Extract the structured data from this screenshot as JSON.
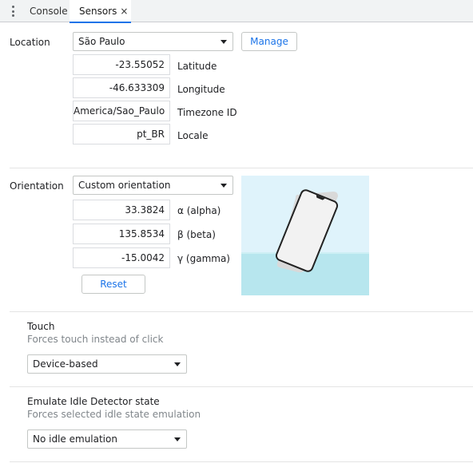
{
  "tabs": [
    {
      "label": "Console"
    },
    {
      "label": "Sensors",
      "close": "×"
    }
  ],
  "location": {
    "label": "Location",
    "selected": "São Paulo",
    "manage": "Manage",
    "latitude": {
      "value": "-23.55052",
      "label": "Latitude"
    },
    "longitude": {
      "value": "-46.633309",
      "label": "Longitude"
    },
    "timezone": {
      "value": "America/Sao_Paulo",
      "label": "Timezone ID"
    },
    "locale": {
      "value": "pt_BR",
      "label": "Locale"
    }
  },
  "orientation": {
    "label": "Orientation",
    "selected": "Custom orientation",
    "alpha": {
      "value": "33.3824",
      "label": "α (alpha)"
    },
    "beta": {
      "value": "135.8534",
      "label": "β (beta)"
    },
    "gamma": {
      "value": "-15.0042",
      "label": "γ (gamma)"
    },
    "reset": "Reset"
  },
  "touch": {
    "title": "Touch",
    "description": "Forces touch instead of click",
    "selected": "Device-based"
  },
  "idle": {
    "title": "Emulate Idle Detector state",
    "description": "Forces selected idle state emulation",
    "selected": "No idle emulation"
  },
  "colors": {
    "accent": "#1a73e8",
    "sky": "#dff3fb",
    "water": "#b7e6ee"
  }
}
